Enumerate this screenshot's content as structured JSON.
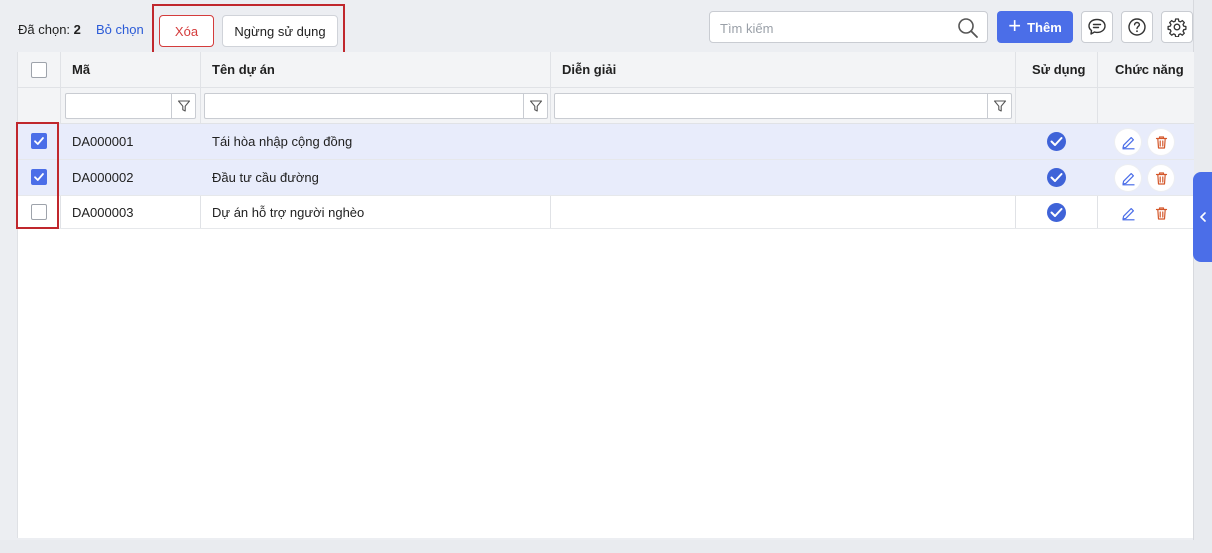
{
  "toolbar": {
    "selected_label": "Đã chọn:",
    "selected_count": "2",
    "deselect_label": "Bỏ chọn",
    "delete_label": "Xóa",
    "stop_using_label": "Ngừng sử dụng",
    "search_placeholder": "Tìm kiếm",
    "add_label": "Thêm",
    "icons": [
      "search-icon",
      "plus-icon",
      "chat-icon",
      "help-icon",
      "settings-icon"
    ]
  },
  "table": {
    "columns": [
      "Mã",
      "Tên dự án",
      "Diễn giải",
      "Sử dụng",
      "Chức năng"
    ],
    "rows": [
      {
        "selected": true,
        "code": "DA000001",
        "name": "Tái hòa nhập cộng đồng",
        "description": "",
        "in_use": true
      },
      {
        "selected": true,
        "code": "DA000002",
        "name": "Đầu tư cầu đường",
        "description": "",
        "in_use": true
      },
      {
        "selected": false,
        "code": "DA000003",
        "name": "Dự án hỗ trợ người nghèo",
        "description": "",
        "in_use": true
      }
    ]
  },
  "colors": {
    "accent": "#4b6ee8",
    "danger": "#d43c3c",
    "highlight_border": "#c0272d",
    "selected_row": "#e8ecfb"
  }
}
